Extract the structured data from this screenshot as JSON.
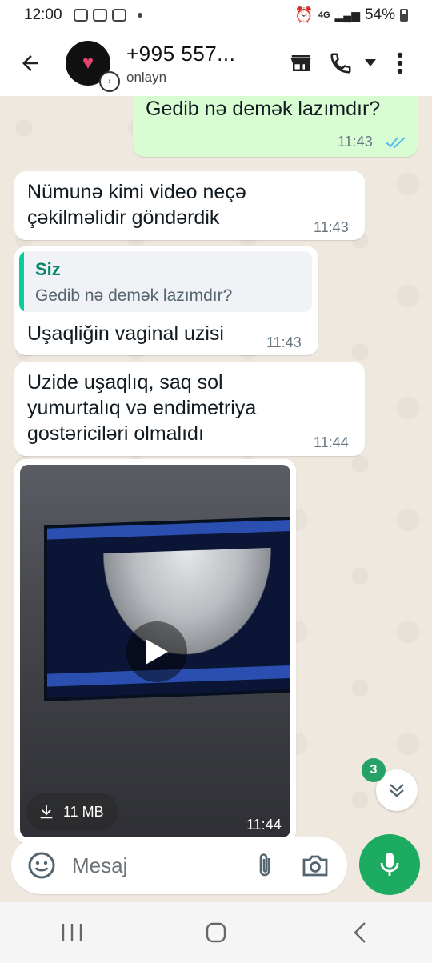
{
  "status_bar": {
    "time": "12:00",
    "battery": "54%",
    "network": "4G"
  },
  "header": {
    "contact_name": "+995 557...",
    "status": "onlayn",
    "icons": [
      "back-arrow-icon",
      "store-icon",
      "phone-icon",
      "dropdown-icon",
      "more-vert-icon"
    ]
  },
  "messages": [
    {
      "direction": "out",
      "text": "Gedib nə demək lazımdır?",
      "time": "11:43",
      "status": "read"
    },
    {
      "direction": "in",
      "text_line1": "Nümunə kimi video neçə",
      "text_line2": "çəkilməlidir göndərdik",
      "time": "11:43"
    },
    {
      "direction": "in",
      "quote_author": "Siz",
      "quote_text": "Gedib nə demək lazımdır?",
      "text": "Uşaqliğin vaginal uzisi",
      "time": "11:43"
    },
    {
      "direction": "in",
      "text_line1": "Uzide uşaqlıq, saq sol",
      "text_line2": "yumurtalıq və endimetriya",
      "text_line3": "gostəriciləri olmalıdı",
      "time": "11:44"
    },
    {
      "direction": "in",
      "type": "video",
      "size": "11 MB",
      "time": "11:44"
    }
  ],
  "scroll": {
    "unread_count": "3"
  },
  "composer": {
    "placeholder": "Mesaj"
  },
  "colors": {
    "accent": "#1daa61",
    "outgoing_bubble": "#d9fdd3",
    "incoming_bubble": "#ffffff",
    "chat_bg": "#efe8df",
    "read_tick": "#53bdeb"
  }
}
